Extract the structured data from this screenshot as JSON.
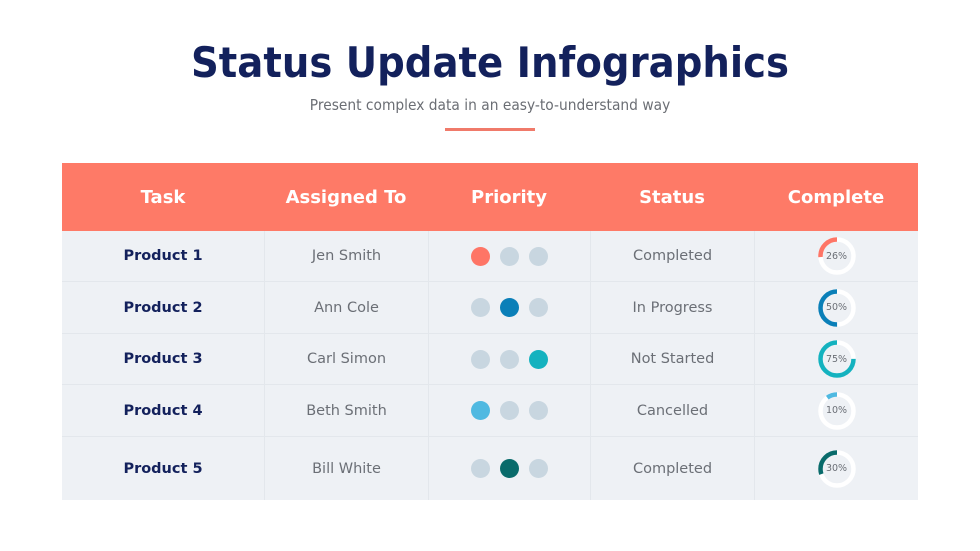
{
  "header": {
    "title": "Status Update Infographics",
    "subtitle": "Present complex data in an easy-to-understand way",
    "accent_color": "#f07a6a"
  },
  "table": {
    "header_color": "#fe7a67",
    "columns": [
      "Task",
      "Assigned To",
      "Priority",
      "Status",
      "Complete"
    ],
    "rows": [
      {
        "task": "Product 1",
        "assigned_to": "Jen Smith",
        "priority_active": 1,
        "priority_color": "#fe7566",
        "status": "Completed",
        "complete": "26%",
        "complete_value": 0.26,
        "ring_color": "#fe7566"
      },
      {
        "task": "Product 2",
        "assigned_to": "Ann Cole",
        "priority_active": 2,
        "priority_color": "#0a7fb8",
        "status": "In Progress",
        "complete": "50%",
        "complete_value": 0.5,
        "ring_color": "#0a7fb8"
      },
      {
        "task": "Product 3",
        "assigned_to": "Carl Simon",
        "priority_active": 3,
        "priority_color": "#14b2bf",
        "status": "Not Started",
        "complete": "75%",
        "complete_value": 0.75,
        "ring_color": "#14b2bf"
      },
      {
        "task": "Product 4",
        "assigned_to": "Beth Smith",
        "priority_active": 1,
        "priority_color": "#4fb9e1",
        "status": "Cancelled",
        "complete": "10%",
        "complete_value": 0.1,
        "ring_color": "#4fb9e1"
      },
      {
        "task": "Product 5",
        "assigned_to": "Bill White",
        "priority_active": 2,
        "priority_color": "#096b6b",
        "status": "Completed",
        "complete": "30%",
        "complete_value": 0.3,
        "ring_color": "#096b6b"
      }
    ]
  }
}
